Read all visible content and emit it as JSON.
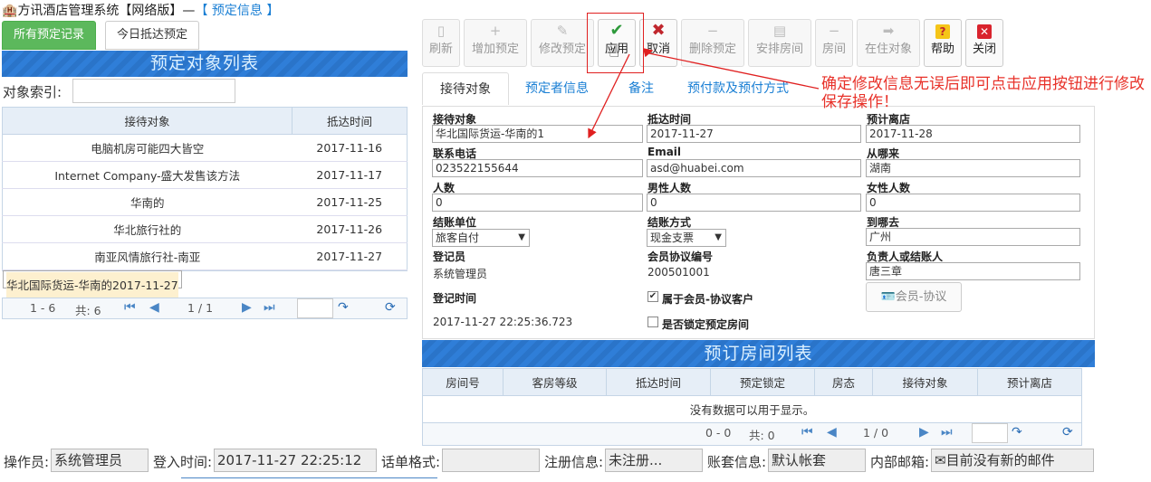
{
  "title": {
    "app": "方讯酒店管理系统【网络版】—",
    "crumb": "【 预定信息 】"
  },
  "left_tabs": [
    "所有预定记录",
    "今日抵达预定"
  ],
  "left_panel": {
    "header": "预定对象列表",
    "index_label": "对象索引:",
    "columns": [
      "接待对象",
      "抵达时间"
    ],
    "rows": [
      [
        "电脑机房可能四大皆空",
        "2017-11-16"
      ],
      [
        "Internet Company-盛大发售该方法",
        "2017-11-17"
      ],
      [
        "华南的",
        "2017-11-25"
      ],
      [
        "华北旅行社的",
        "2017-11-26"
      ],
      [
        "南亚风情旅行社-南亚",
        "2017-11-27"
      ],
      [
        "华北国际货运-华南的",
        "2017-11-27"
      ]
    ],
    "pager": {
      "range": "1 - 6",
      "total": "共: 6",
      "page": "1 / 1"
    }
  },
  "toolbar": [
    {
      "label": "刷新",
      "icon": "refresh-icon"
    },
    {
      "label": "增加预定",
      "icon": "plus-icon"
    },
    {
      "label": "修改预定",
      "icon": "edit-icon"
    },
    {
      "label": "应用",
      "icon": "check-icon"
    },
    {
      "label": "取消",
      "icon": "x-icon"
    },
    {
      "label": "删除预定",
      "icon": "minus-icon"
    },
    {
      "label": "安排房间",
      "icon": "document-icon"
    },
    {
      "label": "房间",
      "icon": "minus-icon"
    },
    {
      "label": "在住对象",
      "icon": "arrow-right-icon"
    },
    {
      "label": "帮助",
      "icon": "help-icon"
    },
    {
      "label": "关闭",
      "icon": "close-icon"
    }
  ],
  "right_tabs": [
    "接待对象",
    "预定者信息",
    "备注",
    "预付款及预付方式"
  ],
  "form": {
    "reception_label": "接待对象",
    "reception_value": "华北国际货运-华南的1",
    "arrival_label": "抵达时间",
    "arrival_value": "2017-11-27",
    "departure_label": "预计离店",
    "departure_value": "2017-11-28",
    "phone_label": "联系电话",
    "phone_value": "023522155644",
    "email_label": "Email",
    "email_value": "asd@huabei.com",
    "from_label": "从哪来",
    "from_value": "湖南",
    "people_label": "人数",
    "people_value": "0",
    "male_label": "男性人数",
    "male_value": "0",
    "female_label": "女性人数",
    "female_value": "0",
    "settle_unit_label": "结账单位",
    "settle_unit_value": "旅客自付",
    "settle_method_label": "结账方式",
    "settle_method_value": "现金支票",
    "to_label": "到哪去",
    "to_value": "广州",
    "registrar_label": "登记员",
    "registrar_value": "系统管理员",
    "member_no_label": "会员协议编号",
    "member_no_value": "200501001",
    "manager_label": "负责人或结账人",
    "manager_value": "唐三章",
    "reg_time_label": "登记时间",
    "reg_time_value": "2017-11-27 22:25:36.723",
    "member_check_label": "属于会员-协议客户",
    "lock_check_label": "是否锁定预定房间",
    "member_button": "会员-协议"
  },
  "room_list": {
    "header": "预订房间列表",
    "columns": [
      "房间号",
      "客房等级",
      "抵达时间",
      "预定锁定",
      "房态",
      "接待对象",
      "预计离店"
    ],
    "empty": "没有数据可以用于显示。",
    "pager": {
      "range": "0 - 0",
      "total": "共: 0",
      "page": "1 / 0"
    }
  },
  "status_bar": {
    "operator_label": "操作员:",
    "operator_value": "系统管理员",
    "login_label": "登入时间:",
    "login_value": "2017-11-27 22:25:12",
    "format_label": "话单格式:",
    "format_value": "",
    "reg_label": "注册信息:",
    "reg_value": "未注册...",
    "account_label": "账套信息:",
    "account_value": "默认帐套",
    "mail_label": "内部邮箱:",
    "mail_value": "目前没有新的邮件"
  },
  "annotation": "确定修改信息无误后即可点击应用按钮进行修改保存操作！",
  "colors": {
    "accent": "#2f7ed8",
    "green": "#5cb85c",
    "annotation": "#e8322a",
    "selected_row": "#fdf0cf"
  }
}
